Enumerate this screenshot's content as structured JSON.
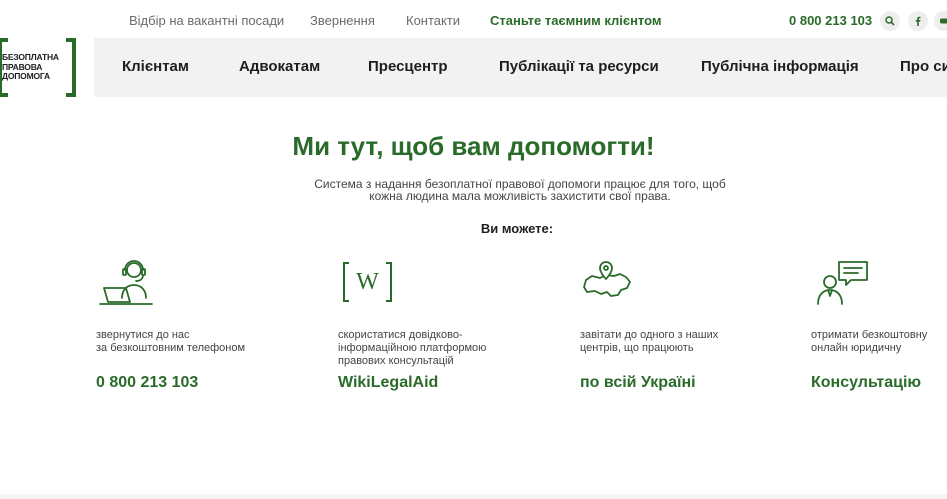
{
  "topbar": {
    "links": [
      "Відбір на вакантні посади",
      "Звернення",
      "Контакти"
    ],
    "secret_client": "Станьте таємним клієнтом",
    "phone": "0 800 213 103"
  },
  "logo": {
    "line1": "БЕЗОПЛАТНА",
    "line2": "ПРАВОВА",
    "line3": "ДОПОМОГА"
  },
  "nav": {
    "items": [
      "Клієнтам",
      "Адвокатам",
      "Пресцентр",
      "Публікації та ресурси",
      "Публічна інформація",
      "Про си"
    ]
  },
  "hero": {
    "title": "Ми тут, щоб вам допомогти!",
    "desc_line1": "Система з надання безоплатної правової допомоги працює для того, щоб",
    "desc_line2": "кожна людина мала можливість захистити свої права.",
    "you_can": "Ви можете:"
  },
  "features": [
    {
      "icon": "headset-operator-icon",
      "desc": [
        "звернутися до нас",
        "за безкоштовним телефоном"
      ],
      "link": "0 800 213 103"
    },
    {
      "icon": "wiki-w-icon",
      "desc": [
        "скористатися довідково-",
        "інформаційною платформою",
        "правових консультацій"
      ],
      "link": "WikiLegalAid"
    },
    {
      "icon": "ukraine-map-pin-icon",
      "desc": [
        "завітати до одного з наших",
        "центрів, що працюють"
      ],
      "link": "по всій Україні"
    },
    {
      "icon": "consultant-chat-icon",
      "desc": [
        "отримати безкоштовну",
        "онлайн юридичну"
      ],
      "link": "Консультацію"
    }
  ],
  "colors": {
    "brand_green": "#2a6b2a",
    "nav_bg": "#f2f2f2",
    "text_gray": "#6b6b6b"
  }
}
